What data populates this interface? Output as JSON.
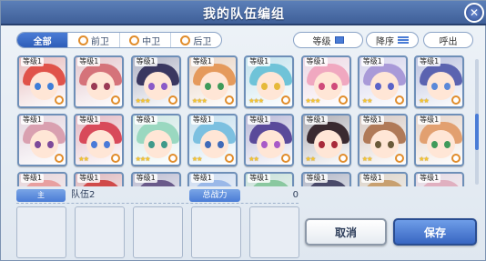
{
  "window": {
    "title": "我的队伍编组",
    "close_label": "✕"
  },
  "filters": {
    "tabs": [
      {
        "label": "全部",
        "active": true
      },
      {
        "label": "前卫",
        "active": false
      },
      {
        "label": "中卫",
        "active": false
      },
      {
        "label": "后卫",
        "active": false
      }
    ]
  },
  "controls": {
    "sort_level_label": "等级",
    "sort_order_label": "降序",
    "show_label": "呼出"
  },
  "roster": {
    "level_text": "等级1",
    "characters": [
      {
        "hair": "#e0534a",
        "eye": "#3f7ed8",
        "stars": ""
      },
      {
        "hair": "#d5737a",
        "eye": "#9a3a55",
        "stars": ""
      },
      {
        "hair": "#3a3760",
        "eye": "#8a5ac8",
        "stars": "★★★"
      },
      {
        "hair": "#e59a5c",
        "eye": "#3f9a5a",
        "stars": "★★★"
      },
      {
        "hair": "#6fc3d8",
        "eye": "#e6b93a",
        "stars": "★★★"
      },
      {
        "hair": "#f0a8c0",
        "eye": "#d04a7a",
        "stars": "★★★"
      },
      {
        "hair": "#a99ad8",
        "eye": "#5a62c8",
        "stars": "★★"
      },
      {
        "hair": "#5b63b0",
        "eye": "#5a88d8",
        "stars": "★★"
      },
      {
        "hair": "#d9a0b0",
        "eye": "#7d4a9a",
        "stars": ""
      },
      {
        "hair": "#d84a5a",
        "eye": "#4a7ad8",
        "stars": "★★"
      },
      {
        "hair": "#9ad8c0",
        "eye": "#3f9a8a",
        "stars": "★★★"
      },
      {
        "hair": "#7cc0e0",
        "eye": "#3f6ab8",
        "stars": "★★"
      },
      {
        "hair": "#5a4a9a",
        "eye": "#a85ac8",
        "stars": "★★"
      },
      {
        "hair": "#3a2a30",
        "eye": "#a82a3a",
        "stars": "★★"
      },
      {
        "hair": "#b07a58",
        "eye": "#6a5a3a",
        "stars": "★★"
      },
      {
        "hair": "#e2a070",
        "eye": "#3f9a5a",
        "stars": "★★"
      },
      {
        "hair": "#e8a0a0",
        "eye": "#a04a4a",
        "stars": ""
      },
      {
        "hair": "#d04a4a",
        "eye": "#3f6ad8",
        "stars": ""
      },
      {
        "hair": "#6a5a8a",
        "eye": "#5a62c8",
        "stars": ""
      },
      {
        "hair": "#9ab8e8",
        "eye": "#3f6ab8",
        "stars": ""
      },
      {
        "hair": "#8ac8a0",
        "eye": "#3f9a5a",
        "stars": ""
      },
      {
        "hair": "#4a4a6a",
        "eye": "#7a5ac8",
        "stars": ""
      },
      {
        "hair": "#c8a070",
        "eye": "#6a5a3a",
        "stars": ""
      },
      {
        "hair": "#e0b0c0",
        "eye": "#a04a8a",
        "stars": ""
      }
    ]
  },
  "team": {
    "slot_tag": "主",
    "name": "队伍2",
    "power_label": "总战力",
    "power_value": "0"
  },
  "buttons": {
    "cancel": "取消",
    "save": "保存"
  }
}
